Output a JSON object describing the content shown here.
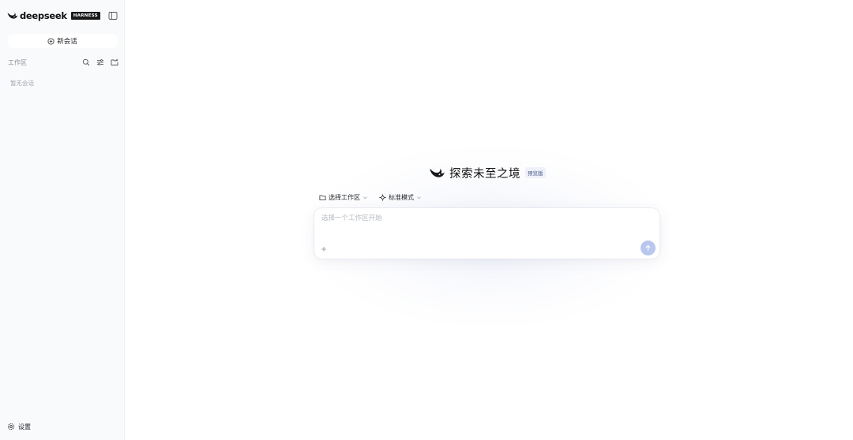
{
  "sidebar": {
    "brand": "deepseek",
    "brand_badge": "HARNESS",
    "new_chat_label": "新会话",
    "workspace_label": "工作区",
    "empty_label": "暂无会话",
    "settings_label": "设置",
    "icons": [
      "whale-logo-icon",
      "sidebar-toggle-icon",
      "plus-circle-icon",
      "search-icon",
      "filter-icon",
      "new-folder-icon",
      "gear-icon"
    ]
  },
  "main": {
    "title": "探索未至之境",
    "badge": "预览版",
    "workspace_select": "选择工作区",
    "mode_select": "标准模式",
    "input_placeholder": "选择一个工作区开始",
    "input_value": "",
    "send_color": "#b9c6ee"
  },
  "colors": {
    "sidebar_bg": "#f9fafb",
    "accent": "#b9c6ee",
    "text": "#1f2329",
    "muted": "#8a8f98"
  }
}
